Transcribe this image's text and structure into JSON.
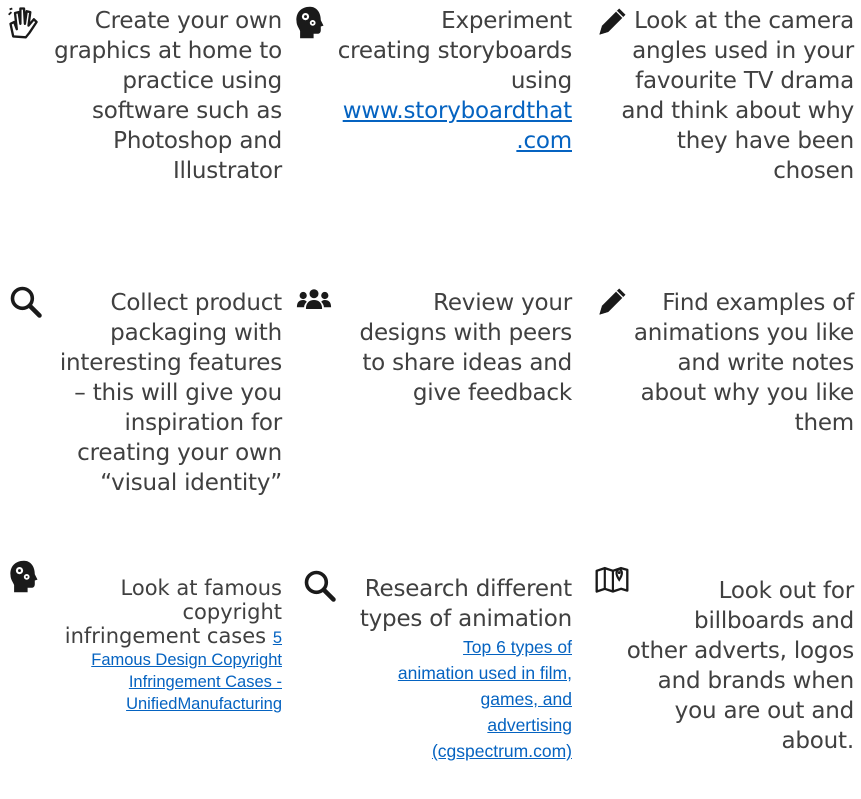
{
  "tips": [
    {
      "icon": "sign-language-icon",
      "lines": [
        "Create your own",
        "graphics at home to",
        "practice using",
        "software such as",
        "Photoshop and",
        "Illustrator"
      ]
    },
    {
      "icon": "head-gears-icon",
      "lines": [
        "Experiment",
        "creating storyboards",
        "using"
      ],
      "link_lines": [
        "www.storyboardthat",
        ".com"
      ]
    },
    {
      "icon": "pencil-icon",
      "lines": [
        "Look at the camera",
        "angles used in your",
        "favourite TV drama",
        "and think about why",
        "they have been",
        "chosen"
      ]
    },
    {
      "icon": "search-icon",
      "lines": [
        "Collect product",
        "packaging with",
        "interesting features",
        "– this will give you",
        "inspiration for",
        "creating your own",
        "“visual identity”"
      ]
    },
    {
      "icon": "users-icon",
      "lines": [
        "Review your",
        "designs with peers",
        "to share ideas and",
        "give feedback"
      ]
    },
    {
      "icon": "pencil-icon",
      "lines": [
        "Find examples of",
        "animations you like",
        "and write notes",
        "about why you like",
        "them"
      ]
    },
    {
      "icon": "head-gears-icon",
      "lines": [
        "Look at famous",
        "copyright",
        "infringement cases"
      ],
      "link_lines": [
        "5",
        "Famous Design Copyright",
        "Infringement Cases -",
        "UnifiedManufacturing"
      ]
    },
    {
      "icon": "search-icon",
      "lines": [
        "Research different",
        "types of animation"
      ],
      "link_lines": [
        "Top 6 types of",
        "animation used in film,",
        "games, and",
        "advertising",
        "(cgspectrum.com)"
      ]
    },
    {
      "icon": "map-icon",
      "lines": [
        "Look out for",
        "billboards and",
        "other adverts, logos",
        "and brands when",
        "you are out and",
        "about."
      ]
    }
  ]
}
